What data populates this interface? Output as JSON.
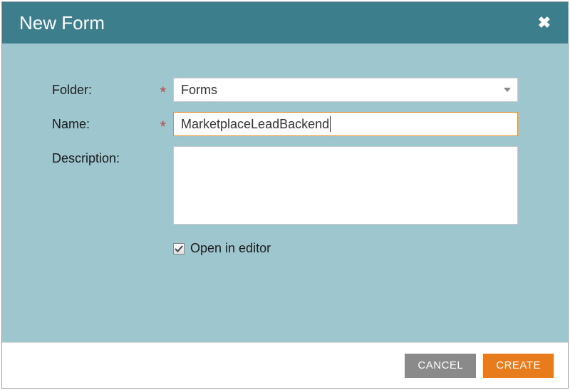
{
  "dialog": {
    "title": "New Form"
  },
  "form": {
    "folder": {
      "label": "Folder:",
      "value": "Forms",
      "required": "*"
    },
    "name": {
      "label": "Name:",
      "value": "MarketplaceLeadBackend",
      "required": "*"
    },
    "description": {
      "label": "Description:",
      "value": ""
    },
    "openInEditor": {
      "label": "Open in editor",
      "checked": true
    }
  },
  "buttons": {
    "cancel": "CANCEL",
    "create": "CREATE"
  }
}
